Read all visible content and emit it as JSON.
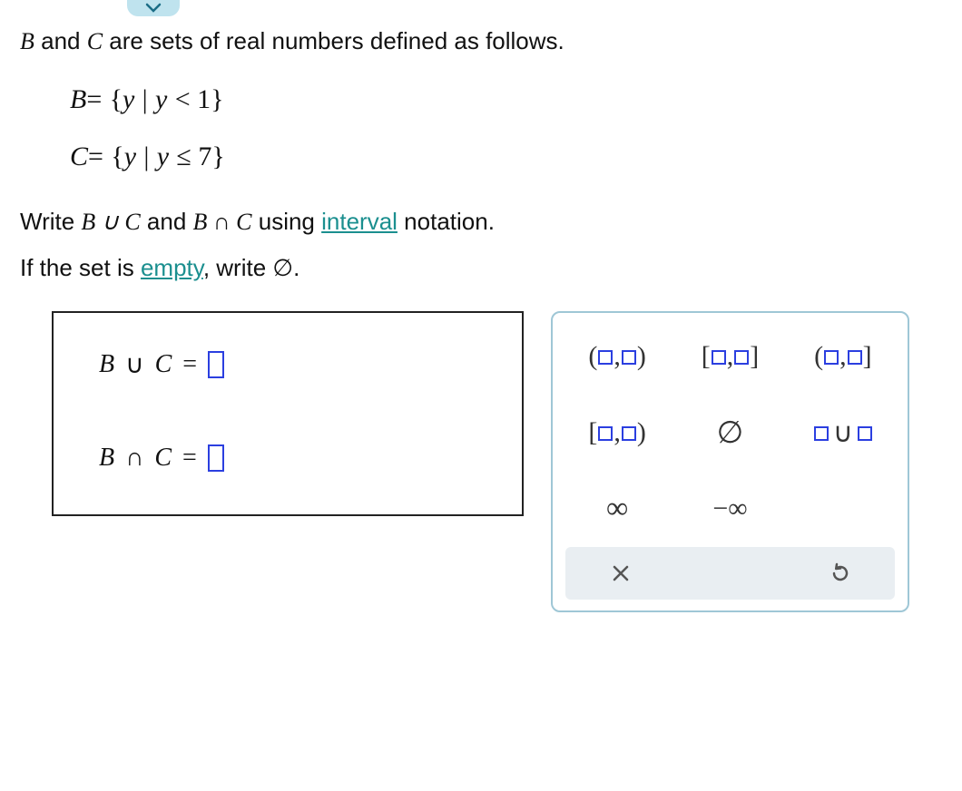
{
  "intro": {
    "part1_pre": "B",
    "part1_mid": " and ",
    "part1_c": "C",
    "part1_post": " are sets of real numbers defined as follows."
  },
  "defs": {
    "b_lhs": "B",
    "b_eq": "=",
    "b_rhs": "{ y | y < 1 }",
    "c_lhs": "C",
    "c_eq": "=",
    "c_rhs": "{ y | y ≤ 7 }"
  },
  "instr": {
    "l1_pre": "Write ",
    "l1_bu": "B ∪ C",
    "l1_mid": " and ",
    "l1_bi": "B ∩ C",
    "l1_post": " using ",
    "l1_link": "interval",
    "l1_end": " notation.",
    "l2_pre": "If the set is ",
    "l2_link": "empty",
    "l2_mid": ", write ",
    "l2_sym": "∅",
    "l2_end": "."
  },
  "answers": {
    "row1_label": "B  ∪  C  =",
    "row2_label": "B  ∩  C  ="
  },
  "palette": {
    "open_open": "( , )",
    "closed_closed": "[ , ]",
    "open_closed": "( , ]",
    "closed_open": "[ , )",
    "empty": "∅",
    "union_tpl": "  ∪  ",
    "inf": "∞",
    "neg_inf": "−∞"
  },
  "footer": {
    "clear": "×",
    "undo": "↺"
  }
}
